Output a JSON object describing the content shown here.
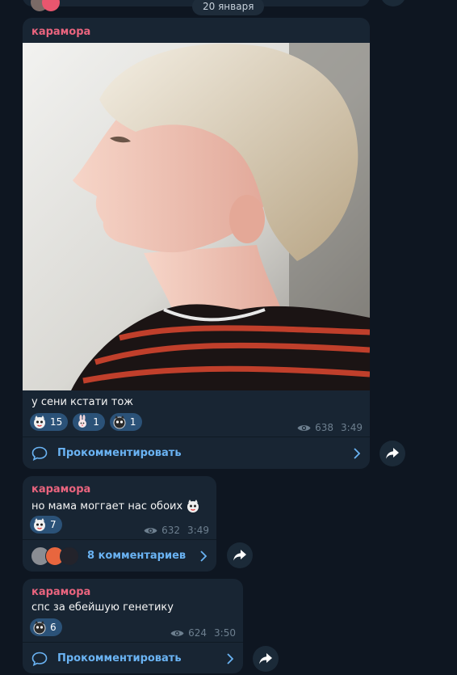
{
  "date_separator": "20 января",
  "messages": [
    {
      "author": "карамора",
      "caption": "у сени кстати тож",
      "reactions": [
        {
          "emoji": "cat-face-sticker-icon",
          "count": "15"
        },
        {
          "emoji": "bunny-sticker-icon",
          "count": "1"
        },
        {
          "emoji": "cat-face-sticker-icon",
          "count": "1"
        }
      ],
      "views": "638",
      "time": "3:49",
      "comment_label": "Прокомментировать"
    },
    {
      "author": "карамора",
      "text": "но мама моггает нас обоих",
      "reactions": [
        {
          "emoji": "cat-face-sticker-icon",
          "count": "7"
        }
      ],
      "views": "632",
      "time": "3:49",
      "comment_label": "8 комментариев"
    },
    {
      "author": "карамора",
      "text": "спс за ебейшую генетику",
      "reactions": [
        {
          "emoji": "cat-face-sticker-icon",
          "count": "6"
        }
      ],
      "views": "624",
      "time": "3:50",
      "comment_label": "Прокомментировать"
    }
  ],
  "colors": {
    "background": "#0e1621",
    "bubble": "#182533",
    "author": "#e9647e",
    "link": "#6ab3f3",
    "reaction_bg": "#2b5278",
    "meta": "#6d7f8f"
  }
}
